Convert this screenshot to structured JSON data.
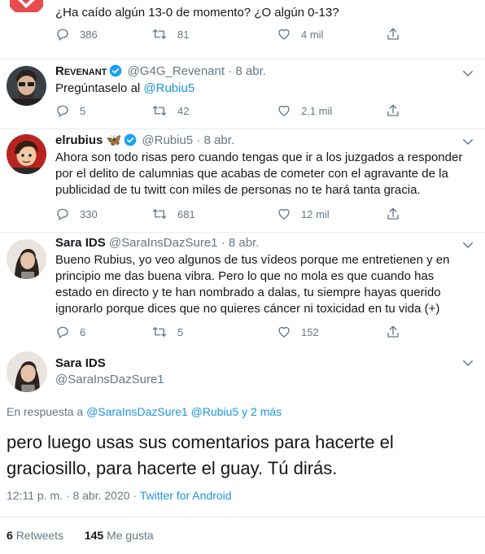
{
  "colors": {
    "text": "#14171a",
    "muted": "#657786",
    "link": "#1b95e0",
    "border": "#e6ecf0",
    "verified": "#1da1f2"
  },
  "tweets": [
    {
      "text": "¿Ha caído algún 13-0 de momento? ¿O algún 0-13?",
      "replies": "386",
      "retweets": "81",
      "likes": "4 mil"
    },
    {
      "name": "Revenant",
      "handle": "@G4G_Revenant",
      "date": "8 abr.",
      "text_prefix": "Pregúntaselo al ",
      "mention": "@Rubiu5",
      "replies": "5",
      "retweets": "42",
      "likes": "2,1 mil"
    },
    {
      "name": "elrubius",
      "emoji": "🦋",
      "handle": "@Rubiu5",
      "date": "8 abr.",
      "text": "Ahora son todo risas pero cuando tengas que ir a los juzgados a responder por el delito de calumnias que acabas de cometer con el agravante de la publicidad de tu twitt con miles de personas no te hará tanta gracia.",
      "replies": "330",
      "retweets": "681",
      "likes": "12 mil"
    },
    {
      "name": "Sara IDS",
      "handle": "@SaraInsDazSure1",
      "date": "8 abr.",
      "text": "Bueno Rubius, yo veo algunos de tus vídeos porque me entretienen y en principio me das buena vibra. Pero lo que no mola es que cuando has estado en directo y te han nombrado a dalas, tu siempre hayas querido ignorarlo porque dices que no quieres cáncer ni toxicidad en tu vida (+)",
      "replies": "6",
      "retweets": "5",
      "likes": "152"
    }
  ],
  "main": {
    "name": "Sara IDS",
    "handle": "@SaraInsDazSure1",
    "reply_prefix": "En respuesta a ",
    "reply_to": "@SaraInsDazSure1 @Rubiu5 y 2 más",
    "text": "pero luego usas sus comentarios para hacerte el graciosillo, para hacerte el guay. Tú dirás.",
    "time": "12:11 p. m.",
    "date": "8 abr. 2020",
    "source": "Twitter for Android",
    "retweets_count": "6",
    "retweets_label": "Retweets",
    "likes_count": "145",
    "likes_label": "Me gusta"
  },
  "icons": {
    "reply": "reply-icon",
    "retweet": "retweet-icon",
    "like": "heart-icon",
    "share": "share-icon",
    "more": "chevron-down-icon",
    "verified": "verified-badge-icon"
  }
}
